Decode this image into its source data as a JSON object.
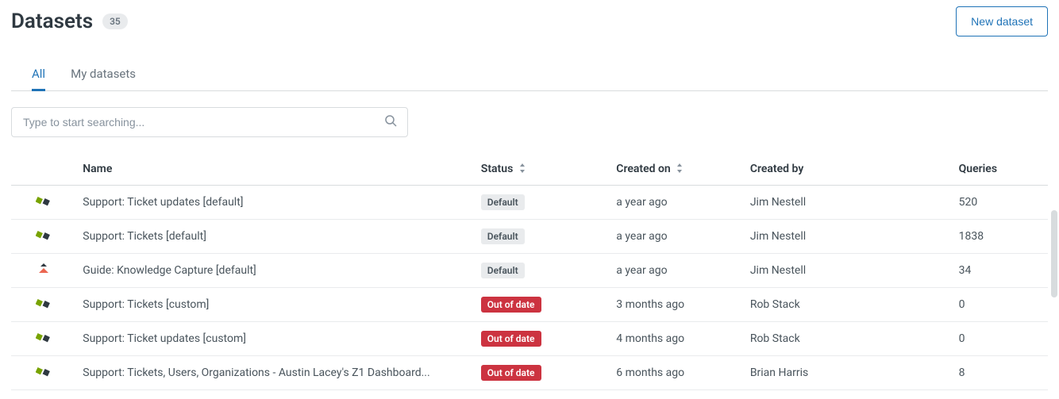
{
  "header": {
    "title": "Datasets",
    "count": "35",
    "new_button": "New dataset"
  },
  "tabs": {
    "all": "All",
    "mine": "My datasets"
  },
  "search": {
    "placeholder": "Type to start searching..."
  },
  "columns": {
    "name": "Name",
    "status": "Status",
    "created_on": "Created on",
    "created_by": "Created by",
    "queries": "Queries"
  },
  "status_labels": {
    "default": "Default",
    "out_of_date": "Out of date"
  },
  "rows": [
    {
      "icon": "support",
      "name": "Support: Ticket updates [default]",
      "status": "default",
      "created_on": "a year ago",
      "created_by": "Jim Nestell",
      "queries": "520"
    },
    {
      "icon": "support",
      "name": "Support: Tickets [default]",
      "status": "default",
      "created_on": "a year ago",
      "created_by": "Jim Nestell",
      "queries": "1838"
    },
    {
      "icon": "guide",
      "name": "Guide: Knowledge Capture [default]",
      "status": "default",
      "created_on": "a year ago",
      "created_by": "Jim Nestell",
      "queries": "34"
    },
    {
      "icon": "support",
      "name": "Support: Tickets [custom]",
      "status": "out_of_date",
      "created_on": "3 months ago",
      "created_by": "Rob Stack",
      "queries": "0"
    },
    {
      "icon": "support",
      "name": "Support: Ticket updates [custom]",
      "status": "out_of_date",
      "created_on": "4 months ago",
      "created_by": "Rob Stack",
      "queries": "0"
    },
    {
      "icon": "support",
      "name": "Support: Tickets, Users, Organizations - Austin Lacey's Z1 Dashboard...",
      "status": "out_of_date",
      "created_on": "6 months ago",
      "created_by": "Brian Harris",
      "queries": "8"
    }
  ]
}
